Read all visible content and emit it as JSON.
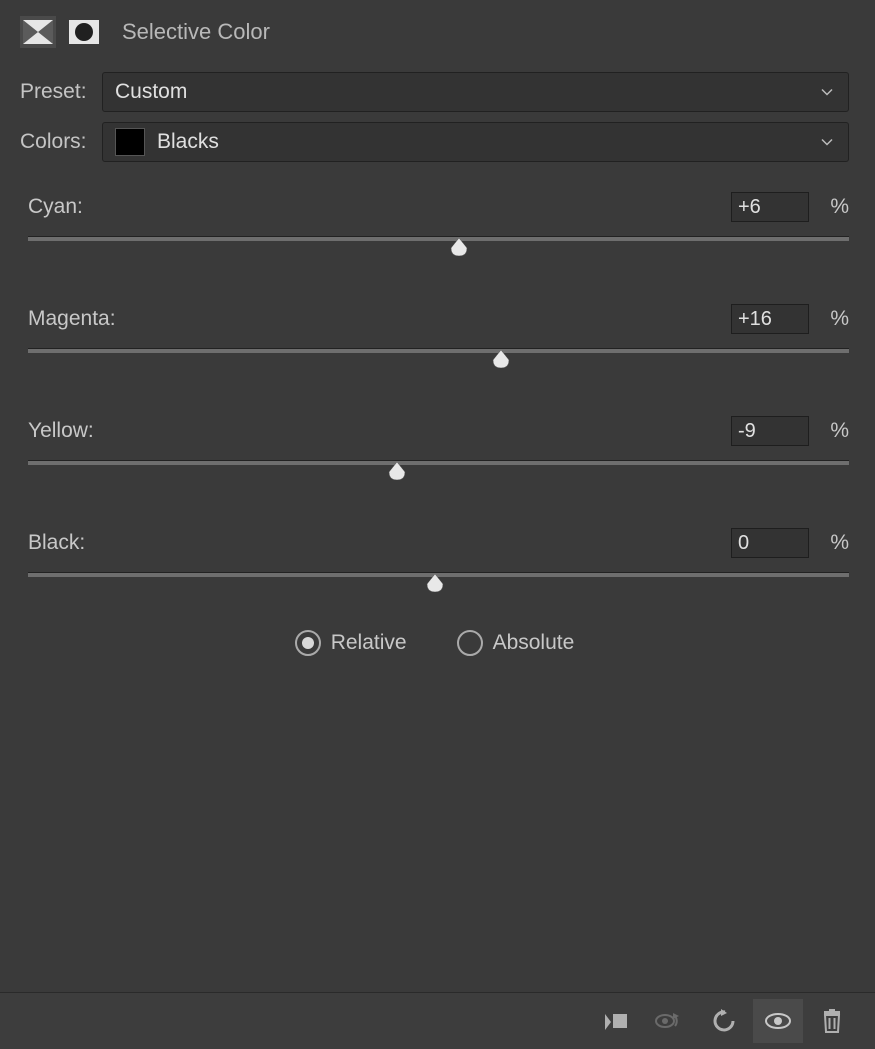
{
  "title": "Selective Color",
  "preset": {
    "label": "Preset:",
    "value": "Custom"
  },
  "colors": {
    "label": "Colors:",
    "value": "Blacks",
    "swatch": "#000000"
  },
  "sliders": {
    "cyan": {
      "label": "Cyan:",
      "value": "+6",
      "percent": 53
    },
    "magenta": {
      "label": "Magenta:",
      "value": "+16",
      "percent": 58
    },
    "yellow": {
      "label": "Yellow:",
      "value": "-9",
      "percent": 45.5
    },
    "black": {
      "label": "Black:",
      "value": "0",
      "percent": 50
    }
  },
  "method": {
    "relative": {
      "label": "Relative",
      "checked": true
    },
    "absolute": {
      "label": "Absolute",
      "checked": false
    }
  },
  "unit": "%"
}
